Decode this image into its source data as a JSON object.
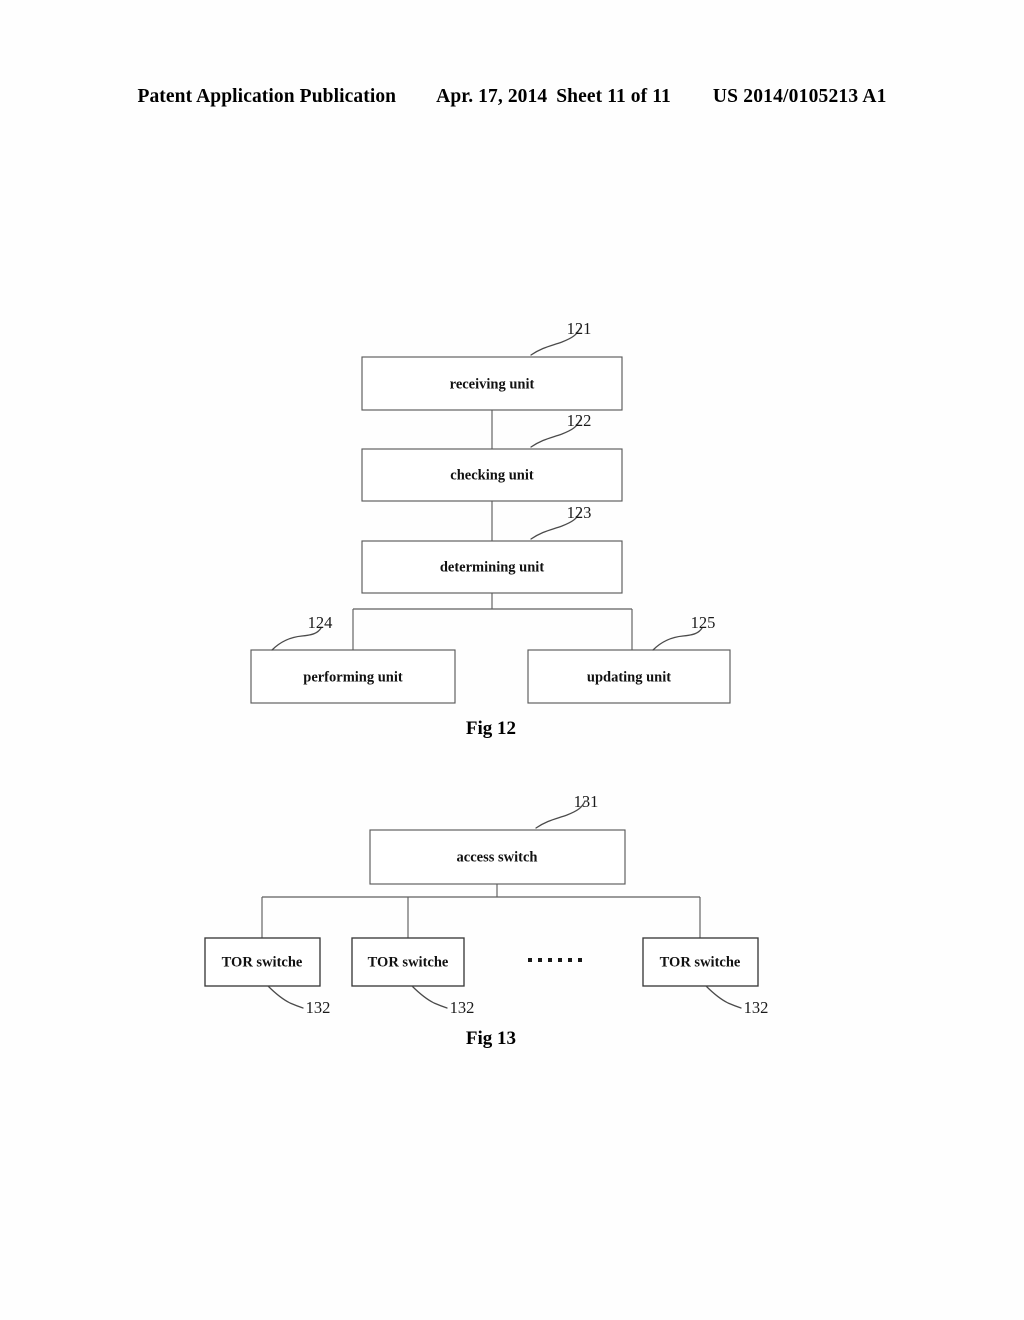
{
  "header": {
    "publication": "Patent Application Publication",
    "date": "Apr. 17, 2014",
    "sheet": "Sheet 11 of 11",
    "document_number": "US 2014/0105213 A1"
  },
  "figures": [
    {
      "caption": "Fig 12",
      "boxes": [
        {
          "label": "receiving unit",
          "numeral": "121"
        },
        {
          "label": "checking unit",
          "numeral": "122"
        },
        {
          "label": "determining unit",
          "numeral": "123"
        },
        {
          "label": "performing unit",
          "numeral": "124"
        },
        {
          "label": "updating unit",
          "numeral": "125"
        }
      ]
    },
    {
      "caption": "Fig 13",
      "boxes": [
        {
          "label": "access switch",
          "numeral": "131"
        },
        {
          "label": "TOR switche",
          "numeral": "132"
        },
        {
          "label": "TOR switche",
          "numeral": "132"
        },
        {
          "label": "TOR switche",
          "numeral": "132"
        }
      ],
      "ellipsis": "······"
    }
  ],
  "colors": {
    "ink": "#000000",
    "line": "#5a5a5a",
    "paper": "#ffffff"
  }
}
